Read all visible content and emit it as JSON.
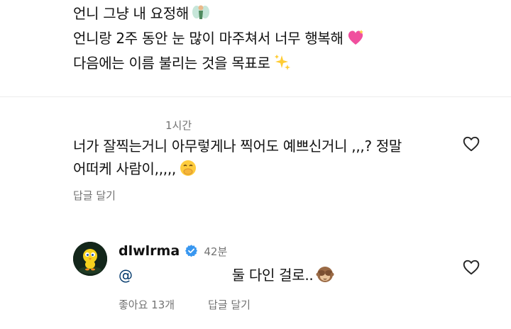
{
  "caption": {
    "lines": [
      "언니 그냥 내 요정해",
      "언니랑 2주 동안 눈 많이 마주쳐서 너무 행복해",
      "다음에는 이름 불리는 것을 목표로"
    ],
    "emojis": [
      "fairy-emoji",
      "sparkling-heart-emoji",
      "sparkles-emoji"
    ]
  },
  "comment1": {
    "timestamp": "1시간",
    "line1": "너가 잘찍는거니 아무렇게나 찍어도 예쁘신거니 ,,,? 정말",
    "line2": "어떠케 사람이,,,,,",
    "emoji": "face-with-hand-over-mouth-emoji",
    "reply_label": "답글 달기",
    "like_icon": "heart-outline-icon"
  },
  "comment2": {
    "username": "dlwlrma",
    "verified_icon": "verified-badge-icon",
    "timestamp": "42분",
    "mention_prefix": "@",
    "text": "둘 다인 걸로..",
    "emoji": "see-no-evil-monkey-emoji",
    "likes_label": "좋아요 13개",
    "reply_label": "답글 달기",
    "like_icon": "heart-outline-icon",
    "avatar": "tweety-avatar"
  },
  "colors": {
    "text": "#111111",
    "muted": "#737373",
    "verified": "#3897f0",
    "divider": "#ececec"
  }
}
